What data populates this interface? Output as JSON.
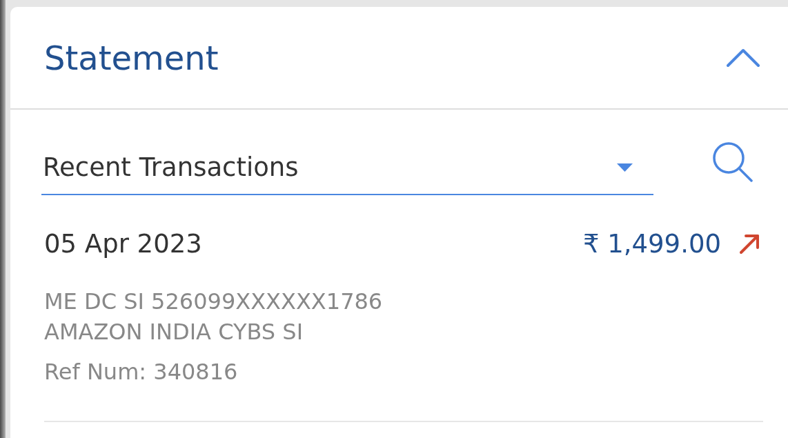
{
  "header": {
    "title": "Statement",
    "expanded": true
  },
  "filter": {
    "value": "Recent Transactions"
  },
  "transactions": [
    {
      "date": "05 Apr 2023",
      "amount": "₹ 1,499.00",
      "kind": "debit",
      "description": [
        "ME DC SI 526099XXXXXX1786",
        "AMAZON INDIA CYBS SI"
      ],
      "ref": "Ref Num: 340816"
    }
  ]
}
